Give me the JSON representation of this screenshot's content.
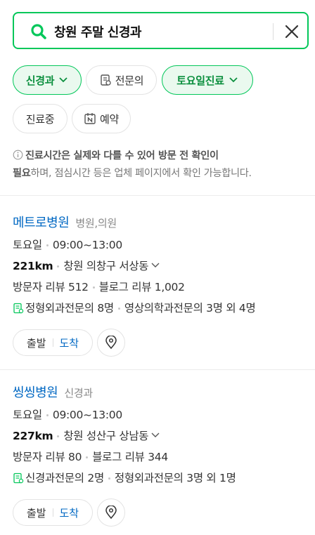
{
  "search": {
    "query": "창원 주말 신경과"
  },
  "filters": [
    {
      "label": "신경과",
      "active": true,
      "icon": "chevron-down-icon"
    },
    {
      "label": "전문의",
      "active": false,
      "icon": "specialist-doc-icon"
    },
    {
      "label": "토요일진료",
      "active": true,
      "icon": "chevron-down-icon"
    },
    {
      "label": "진료중",
      "active": false
    },
    {
      "label": "예약",
      "active": false,
      "icon": "naver-booking-icon"
    }
  ],
  "notice": {
    "bold": "진료시간은 실제와 다를 수 있어 방문 전 확인이",
    "bold2": "필요",
    "rest": "하며, 점심시간 등은 업체 페이지에서 확인 가능합니다."
  },
  "places": [
    {
      "name": "메트로병원",
      "category": "병원,의원",
      "day": "토요일",
      "hours": "09:00~13:00",
      "distance": "221km",
      "address": "창원 의창구 서상동",
      "visitor_review": "방문자 리뷰 512",
      "blog_review": "블로그 리뷰 1,002",
      "doctors": "정형외과전문의 8명",
      "doctors2": "영상의학과전문의 3명 외 4명",
      "depart_label": "출발",
      "arrive_label": "도착"
    },
    {
      "name": "씽씽병원",
      "category": "신경과",
      "day": "토요일",
      "hours": "09:00~13:00",
      "distance": "227km",
      "address": "창원 성산구 상남동",
      "visitor_review": "방문자 리뷰 80",
      "blog_review": "블로그 리뷰 344",
      "doctors": "신경과전문의 2명",
      "doctors2": "정형외과전문의 3명 외 1명",
      "depart_label": "출발",
      "arrive_label": "도착"
    }
  ],
  "colors": {
    "accent": "#03c75a",
    "link": "#0068c3"
  }
}
